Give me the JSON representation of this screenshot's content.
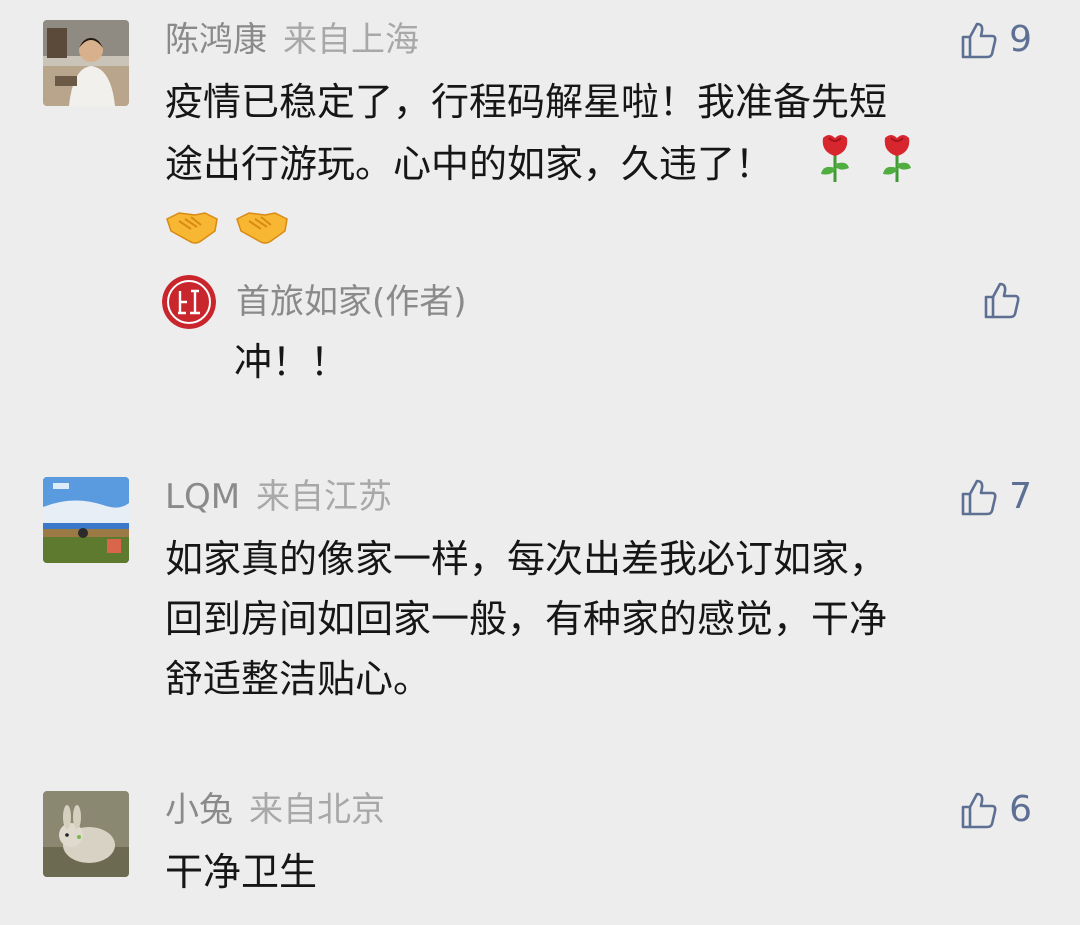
{
  "comments": [
    {
      "author": "陈鸿康",
      "location": "来自上海",
      "likes": "9",
      "lines": [
        "疫情已稳定了，行程码解星啦！我准备先短",
        "途出行游玩。心中的如家，久违了！"
      ],
      "emoji_line1": [
        "rose-emoji",
        "rose-emoji"
      ],
      "emoji_line2": [
        "handshake-emoji",
        "handshake-emoji"
      ],
      "reply": {
        "author": "首旅如家(作者)",
        "text": "冲！！"
      }
    },
    {
      "author": "LQM",
      "location": "来自江苏",
      "likes": "7",
      "lines": [
        "如家真的像家一样，每次出差我必订如家，",
        "回到房间如回家一般，有种家的感觉，干净",
        "舒适整洁贴心。"
      ]
    },
    {
      "author": "小兔",
      "location": "来自北京",
      "likes": "6",
      "lines": [
        "干净卫生"
      ]
    }
  ],
  "colors": {
    "background": "#ededed",
    "name": "#8a8a8a",
    "text": "#161616",
    "like": "#5d6f93",
    "seal": "#c8262c"
  },
  "icons": {
    "like": "thumbs-up-icon"
  }
}
